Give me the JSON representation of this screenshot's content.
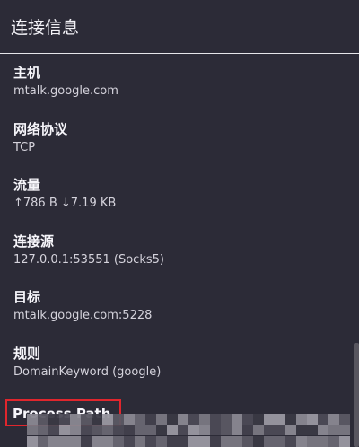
{
  "panel": {
    "title": "连接信息"
  },
  "fields": [
    {
      "label": "主机",
      "value": "mtalk.google.com"
    },
    {
      "label": "网络协议",
      "value": "TCP"
    },
    {
      "label": "流量",
      "value": "↑786 B ↓7.19 KB"
    },
    {
      "label": "连接源",
      "value": "127.0.0.1:53551 (Socks5)"
    },
    {
      "label": "目标",
      "value": "mtalk.google.com:5228"
    },
    {
      "label": "规则",
      "value": "DomainKeyword (google)"
    }
  ],
  "process_path": {
    "label": "Process Path",
    "highlight_color": "#e0262d"
  },
  "colors": {
    "background": "#2c2b37",
    "header_text": "#f2f1f6",
    "divider": "#e6e6ea"
  }
}
